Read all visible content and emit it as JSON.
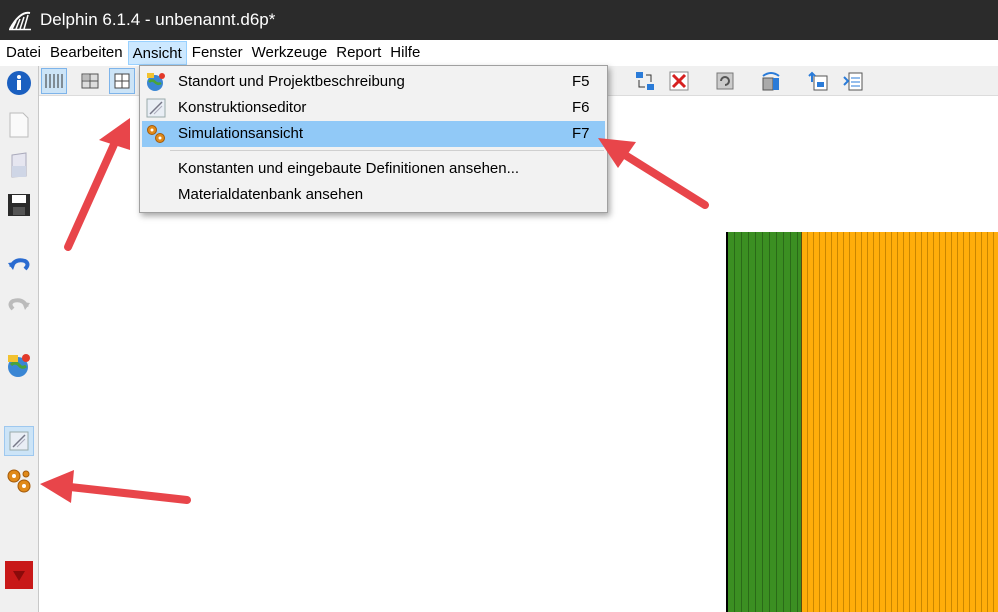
{
  "window": {
    "title": "Delphin 6.1.4 - unbenannt.d6p*"
  },
  "menubar": {
    "items": [
      {
        "label": "Datei"
      },
      {
        "label": "Bearbeiten"
      },
      {
        "label": "Ansicht"
      },
      {
        "label": "Fenster"
      },
      {
        "label": "Werkzeuge"
      },
      {
        "label": "Report"
      },
      {
        "label": "Hilfe"
      }
    ],
    "active": "Ansicht"
  },
  "view_menu": {
    "items": [
      {
        "label": "Standort und Projektbeschreibung",
        "shortcut": "F5",
        "icon": "globe-location-icon"
      },
      {
        "label": "Konstruktionseditor",
        "shortcut": "F6",
        "icon": "construction-editor-icon"
      },
      {
        "label": "Simulationsansicht",
        "shortcut": "F7",
        "icon": "gears-icon",
        "highlighted": true
      },
      {
        "label": "Konstanten und eingebaute Definitionen ansehen...",
        "shortcut": ""
      },
      {
        "label": "Materialdatenbank ansehen",
        "shortcut": ""
      }
    ]
  },
  "left_toolbar": {
    "icons": [
      "info-icon",
      "new-file-icon",
      "open-file-icon",
      "save-icon",
      "undo-icon",
      "redo-icon",
      "location-globe-icon",
      "construction-editor-icon",
      "simulation-gears-icon",
      "stop-icon"
    ]
  },
  "colors": {
    "titlebar": "#2b2b2b",
    "menu_highlight": "#91c9f7",
    "layer_green": "#3b8f22",
    "layer_orange": "#ffad0a",
    "annotation_arrow": "#e8454a"
  }
}
